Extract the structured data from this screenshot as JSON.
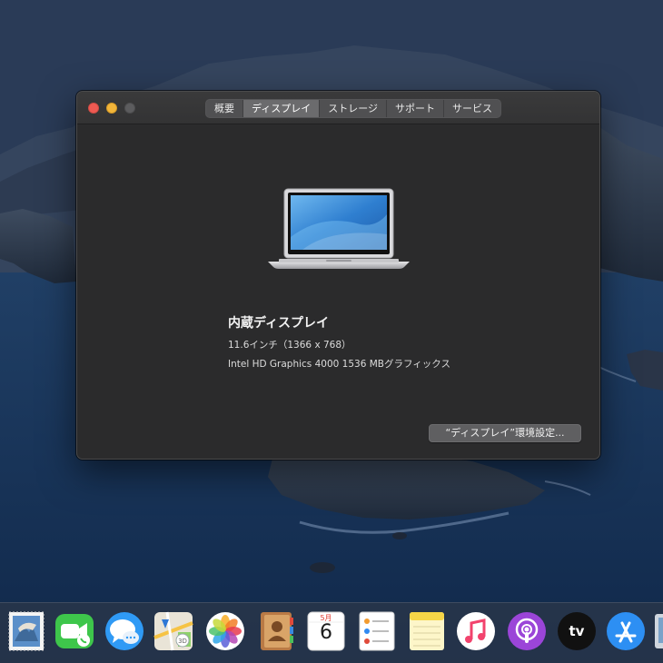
{
  "window": {
    "tabs": [
      {
        "label": "概要",
        "active": false
      },
      {
        "label": "ディスプレイ",
        "active": true
      },
      {
        "label": "ストレージ",
        "active": false
      },
      {
        "label": "サポート",
        "active": false
      },
      {
        "label": "サービス",
        "active": false
      }
    ],
    "display": {
      "title": "内蔵ディスプレイ",
      "size": "11.6インチ（1366 x 768）",
      "graphics": "Intel HD Graphics 4000 1536 MBグラフィックス"
    },
    "prefs_button_label": "“ディスプレイ”環境設定..."
  },
  "dock": {
    "items": [
      {
        "name": "mail",
        "icon": "mail-stamp-icon"
      },
      {
        "name": "facetime",
        "icon": "facetime-icon"
      },
      {
        "name": "messages",
        "icon": "messages-icon"
      },
      {
        "name": "maps",
        "icon": "maps-icon"
      },
      {
        "name": "photos",
        "icon": "photos-icon"
      },
      {
        "name": "contacts",
        "icon": "contacts-icon"
      },
      {
        "name": "calendar",
        "icon": "calendar-icon",
        "month": "5月",
        "day": "6"
      },
      {
        "name": "reminders",
        "icon": "reminders-icon"
      },
      {
        "name": "notes",
        "icon": "notes-icon"
      },
      {
        "name": "music",
        "icon": "music-icon"
      },
      {
        "name": "podcasts",
        "icon": "podcasts-icon"
      },
      {
        "name": "tv",
        "icon": "apple-tv-icon",
        "label": "tv"
      },
      {
        "name": "app-store",
        "icon": "app-store-icon"
      },
      {
        "name": "preview",
        "icon": "preview-icon"
      }
    ]
  },
  "colors": {
    "close": "#ee5a52",
    "minimize": "#f2b53a",
    "zoom_inactive": "#5c5c5e",
    "window_bg": "#2b2b2c",
    "tab_active": "#6b6b6d"
  }
}
